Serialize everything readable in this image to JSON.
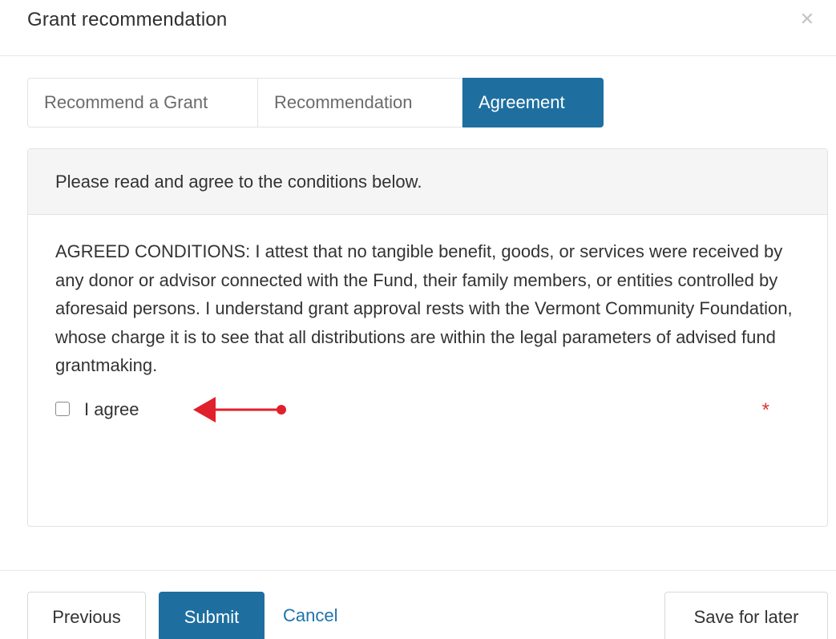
{
  "modal": {
    "title": "Grant recommendation",
    "close_icon": "close-icon"
  },
  "tabs": [
    {
      "label": "Recommend a Grant",
      "active": false
    },
    {
      "label": "Recommendation",
      "active": false
    },
    {
      "label": "Agreement",
      "active": true
    }
  ],
  "panel": {
    "heading": "Please read and agree to the conditions below.",
    "conditions": "AGREED CONDITIONS: I attest that no tangible benefit, goods, or services were received by any donor or advisor connected with the Fund, their family members, or entities controlled by aforesaid persons. I understand grant approval rests with the Vermont Community Foundation, whose charge it is to see that all distributions are within the legal parameters of advised fund grantmaking.",
    "agree_label": "I agree",
    "agree_checked": false,
    "required_marker": "*",
    "annotation_icon": "arrow-left-icon"
  },
  "footer": {
    "previous_label": "Previous",
    "submit_label": "Submit",
    "cancel_label": "Cancel",
    "save_label": "Save for later"
  },
  "colors": {
    "primary": "#1e6fa0",
    "link": "#1e73ad",
    "required": "#e0332f",
    "annotation_arrow": "#e0202a",
    "panel_heading_bg": "#f5f5f5"
  }
}
